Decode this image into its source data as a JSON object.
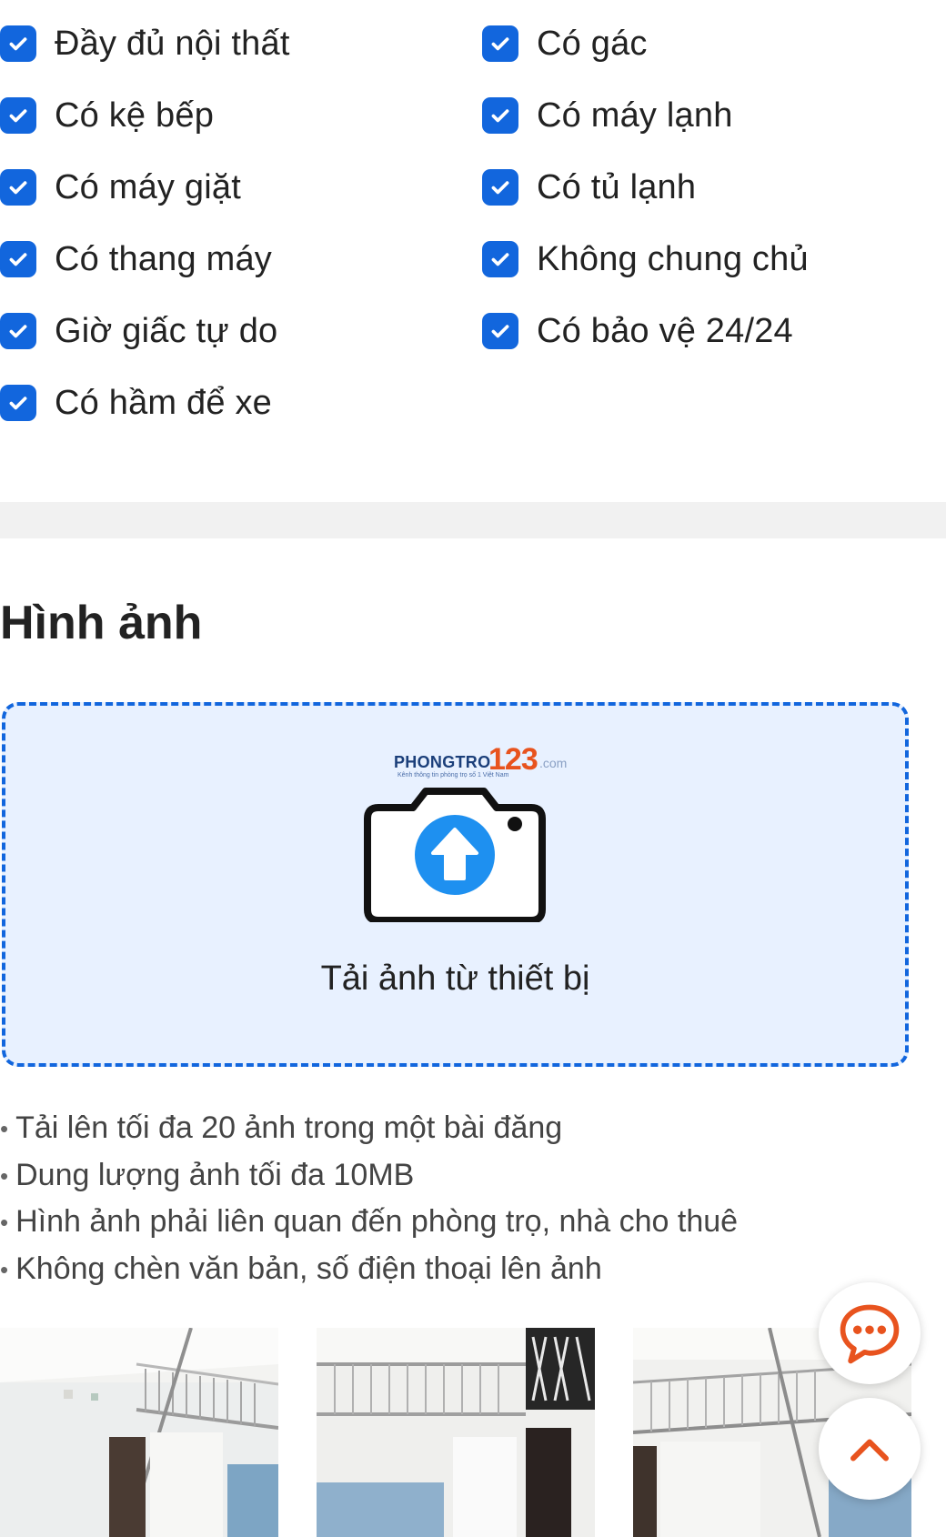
{
  "amenities": {
    "left": [
      {
        "label": "Đầy đủ nội thất",
        "checked": true
      },
      {
        "label": "Có kệ bếp",
        "checked": true
      },
      {
        "label": "Có máy giặt",
        "checked": true
      },
      {
        "label": "Có thang máy",
        "checked": true
      },
      {
        "label": "Giờ giấc tự do",
        "checked": true
      },
      {
        "label": "Có hầm để xe",
        "checked": true
      }
    ],
    "right": [
      {
        "label": "Có gác",
        "checked": true
      },
      {
        "label": "Có máy lạnh",
        "checked": true
      },
      {
        "label": "Có tủ lạnh",
        "checked": true
      },
      {
        "label": "Không chung chủ",
        "checked": true
      },
      {
        "label": "Có bảo vệ 24/24",
        "checked": true
      }
    ]
  },
  "images_section": {
    "title": "Hình ảnh",
    "upload": {
      "logo_text": "PHONGTRO",
      "logo_number": "123",
      "logo_suffix": ".com",
      "logo_tagline": "Kênh thông tin phòng trọ số 1 Việt Nam",
      "label": "Tải ảnh từ thiết bị"
    },
    "rules": [
      "Tải lên tối đa 20 ảnh trong một bài đăng",
      "Dung lượng ảnh tối đa 10MB",
      "Hình ảnh phải liên quan đến phòng trọ, nhà cho thuê",
      "Không chèn văn bản, số điện thoại lên ảnh"
    ],
    "photo_count": 3
  },
  "colors": {
    "accent": "#1266dd",
    "upload_bg": "#e8f1ff",
    "fab_icon": "#e8531e",
    "divider": "#f1f1f1"
  },
  "icons": {
    "checkbox": "check-icon",
    "upload": "camera-upload-icon",
    "chat": "chat-bubble-icon",
    "scroll_top": "chevron-up-icon"
  }
}
